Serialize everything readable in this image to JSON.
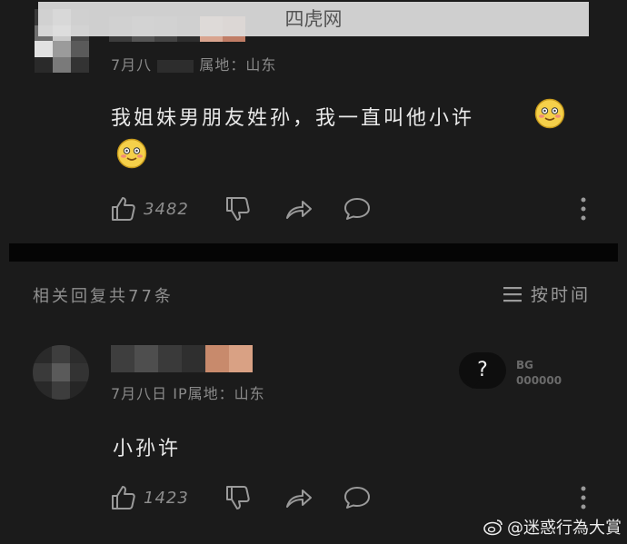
{
  "site_banner": "四虎网",
  "comment1": {
    "meta": "7月八",
    "meta_location": "属地：山东",
    "text": "我姐妹男朋友姓孙，我一直叫他小许",
    "likes": "3482"
  },
  "replies_header": "相关回复共77条",
  "sort": {
    "label": "按时间"
  },
  "reply1": {
    "meta": "7月八日 IP属地：山东",
    "text": "小孙许",
    "likes": "1423"
  },
  "help_widget": {
    "symbol": "?",
    "text_line1": "BG",
    "text_line2": "000000"
  },
  "watermark": "@迷惑行為大賞",
  "icons": {
    "like": "thumbs-up-icon",
    "dislike": "thumbs-down-icon",
    "share": "share-icon",
    "reply": "comment-bubble-icon",
    "more": "more-vertical-icon",
    "emoji": "blushing-smile-emoji-icon",
    "sort": "sort-lines-icon",
    "weibo": "weibo-logo-icon"
  }
}
